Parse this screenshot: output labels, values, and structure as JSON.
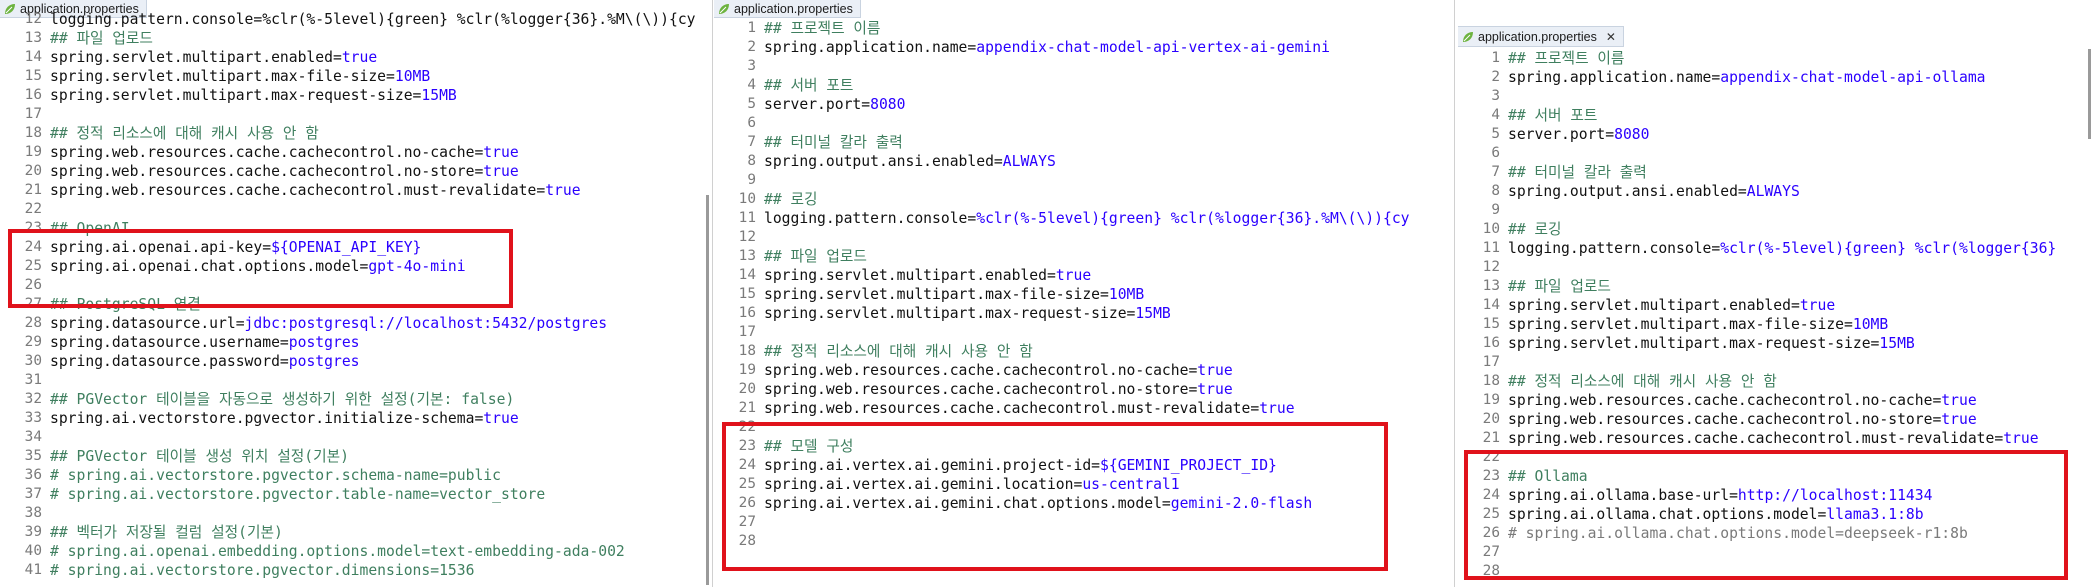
{
  "colors": {
    "key": "#111111",
    "value": "#2a00ff",
    "comment": "#3f7f5f",
    "highlight_box": "#e0121b"
  },
  "panes": [
    {
      "tab": {
        "icon": "leaf-icon",
        "label": "application.properties",
        "close": ""
      },
      "lines": [
        {
          "n": "12",
          "p": [
            {
              "t": "logging.pattern.console=%clr(%-5level){green} %clr(%logger{36}.%M\\(\\)){cy",
              "s": "k"
            }
          ]
        },
        {
          "n": "13",
          "p": [
            {
              "t": "## 파일 업로드",
              "s": "c"
            }
          ]
        },
        {
          "n": "14",
          "p": [
            {
              "t": "spring.servlet.multipart.enabled=",
              "s": "k"
            },
            {
              "t": "true",
              "s": "v"
            }
          ]
        },
        {
          "n": "15",
          "p": [
            {
              "t": "spring.servlet.multipart.max-file-size=",
              "s": "k"
            },
            {
              "t": "10MB",
              "s": "v"
            }
          ]
        },
        {
          "n": "16",
          "p": [
            {
              "t": "spring.servlet.multipart.max-request-size=",
              "s": "k"
            },
            {
              "t": "15MB",
              "s": "v"
            }
          ]
        },
        {
          "n": "17",
          "p": []
        },
        {
          "n": "18",
          "p": [
            {
              "t": "## 정적 리소스에 대해 캐시 사용 안 함",
              "s": "c"
            }
          ]
        },
        {
          "n": "19",
          "p": [
            {
              "t": "spring.web.resources.cache.cachecontrol.no-cache=",
              "s": "k"
            },
            {
              "t": "true",
              "s": "v"
            }
          ]
        },
        {
          "n": "20",
          "p": [
            {
              "t": "spring.web.resources.cache.cachecontrol.no-store=",
              "s": "k"
            },
            {
              "t": "true",
              "s": "v"
            }
          ]
        },
        {
          "n": "21",
          "p": [
            {
              "t": "spring.web.resources.cache.cachecontrol.must-revalidate=",
              "s": "k"
            },
            {
              "t": "true",
              "s": "v"
            }
          ]
        },
        {
          "n": "22",
          "p": []
        },
        {
          "n": "23",
          "p": [
            {
              "t": "## OpenAI",
              "s": "c"
            }
          ]
        },
        {
          "n": "24",
          "p": [
            {
              "t": "spring.ai.openai.api-key=",
              "s": "k"
            },
            {
              "t": "${OPENAI_API_KEY}",
              "s": "v"
            }
          ]
        },
        {
          "n": "25",
          "p": [
            {
              "t": "spring.ai.openai.chat.options.model=",
              "s": "k"
            },
            {
              "t": "gpt-4o-mini",
              "s": "v"
            }
          ]
        },
        {
          "n": "26",
          "p": []
        },
        {
          "n": "27",
          "p": [
            {
              "t": "## PostgreSQL 연결",
              "s": "c"
            }
          ]
        },
        {
          "n": "28",
          "p": [
            {
              "t": "spring.datasource.url=",
              "s": "k"
            },
            {
              "t": "jdbc:postgresql://localhost:5432/postgres",
              "s": "v"
            }
          ]
        },
        {
          "n": "29",
          "p": [
            {
              "t": "spring.datasource.username=",
              "s": "k"
            },
            {
              "t": "postgres",
              "s": "v"
            }
          ]
        },
        {
          "n": "30",
          "p": [
            {
              "t": "spring.datasource.password=",
              "s": "k"
            },
            {
              "t": "postgres",
              "s": "v"
            }
          ]
        },
        {
          "n": "31",
          "p": []
        },
        {
          "n": "32",
          "p": [
            {
              "t": "## PGVector 테이블을 자동으로 생성하기 위한 설정(기본: false)",
              "s": "c"
            }
          ]
        },
        {
          "n": "33",
          "p": [
            {
              "t": "spring.ai.vectorstore.pgvector.initialize-schema=",
              "s": "k"
            },
            {
              "t": "true",
              "s": "v"
            }
          ]
        },
        {
          "n": "34",
          "p": []
        },
        {
          "n": "35",
          "p": [
            {
              "t": "## PGVector 테이블 생성 위치 설정(기본)",
              "s": "c"
            }
          ]
        },
        {
          "n": "36",
          "p": [
            {
              "t": "# spring.ai.vectorstore.pgvector.schema-name=public",
              "s": "c"
            }
          ]
        },
        {
          "n": "37",
          "p": [
            {
              "t": "# spring.ai.vectorstore.pgvector.table-name=vector_store",
              "s": "c"
            }
          ]
        },
        {
          "n": "38",
          "p": []
        },
        {
          "n": "39",
          "p": [
            {
              "t": "## 벡터가 저장될 컬럼 설정(기본)",
              "s": "c"
            }
          ]
        },
        {
          "n": "40",
          "p": [
            {
              "t": "# spring.ai.openai.embedding.options.model=text-embedding-ada-002",
              "s": "c"
            }
          ]
        },
        {
          "n": "41",
          "p": [
            {
              "t": "# spring.ai.vectorstore.pgvector.dimensions=1536",
              "s": "c"
            }
          ]
        }
      ]
    },
    {
      "tab": {
        "icon": "leaf-icon",
        "label": "application.properties",
        "close": ""
      },
      "lines": [
        {
          "n": "1",
          "p": [
            {
              "t": "## 프로젝트 이름",
              "s": "c"
            }
          ]
        },
        {
          "n": "2",
          "p": [
            {
              "t": "spring.application.name=",
              "s": "k"
            },
            {
              "t": "appendix-chat-model-api-vertex-ai-gemini",
              "s": "v"
            }
          ]
        },
        {
          "n": "3",
          "p": []
        },
        {
          "n": "4",
          "p": [
            {
              "t": "## 서버 포트",
              "s": "c"
            }
          ]
        },
        {
          "n": "5",
          "p": [
            {
              "t": "server.port=",
              "s": "k"
            },
            {
              "t": "8080",
              "s": "v"
            }
          ]
        },
        {
          "n": "6",
          "p": []
        },
        {
          "n": "7",
          "p": [
            {
              "t": "## 터미널 칼라 출력",
              "s": "c"
            }
          ]
        },
        {
          "n": "8",
          "p": [
            {
              "t": "spring.output.ansi.enabled=",
              "s": "k"
            },
            {
              "t": "ALWAYS",
              "s": "v"
            }
          ]
        },
        {
          "n": "9",
          "p": []
        },
        {
          "n": "10",
          "p": [
            {
              "t": "## 로깅",
              "s": "c"
            }
          ]
        },
        {
          "n": "11",
          "p": [
            {
              "t": "logging.pattern.console=",
              "s": "k"
            },
            {
              "t": "%clr(%-5level){green} %clr(%logger{36}.%M\\(\\)){cy",
              "s": "v"
            }
          ]
        },
        {
          "n": "12",
          "p": []
        },
        {
          "n": "13",
          "p": [
            {
              "t": "## 파일 업로드",
              "s": "c"
            }
          ]
        },
        {
          "n": "14",
          "p": [
            {
              "t": "spring.servlet.multipart.enabled=",
              "s": "k"
            },
            {
              "t": "true",
              "s": "v"
            }
          ]
        },
        {
          "n": "15",
          "p": [
            {
              "t": "spring.servlet.multipart.max-file-size=",
              "s": "k"
            },
            {
              "t": "10MB",
              "s": "v"
            }
          ]
        },
        {
          "n": "16",
          "p": [
            {
              "t": "spring.servlet.multipart.max-request-size=",
              "s": "k"
            },
            {
              "t": "15MB",
              "s": "v"
            }
          ]
        },
        {
          "n": "17",
          "p": []
        },
        {
          "n": "18",
          "p": [
            {
              "t": "## 정적 리소스에 대해 캐시 사용 안 함",
              "s": "c"
            }
          ]
        },
        {
          "n": "19",
          "p": [
            {
              "t": "spring.web.resources.cache.cachecontrol.no-cache=",
              "s": "k"
            },
            {
              "t": "true",
              "s": "v"
            }
          ]
        },
        {
          "n": "20",
          "p": [
            {
              "t": "spring.web.resources.cache.cachecontrol.no-store=",
              "s": "k"
            },
            {
              "t": "true",
              "s": "v"
            }
          ]
        },
        {
          "n": "21",
          "p": [
            {
              "t": "spring.web.resources.cache.cachecontrol.must-revalidate=",
              "s": "k"
            },
            {
              "t": "true",
              "s": "v"
            }
          ]
        },
        {
          "n": "22",
          "p": []
        },
        {
          "n": "23",
          "p": [
            {
              "t": "## 모델 구성",
              "s": "c"
            }
          ]
        },
        {
          "n": "24",
          "p": [
            {
              "t": "spring.ai.vertex.ai.gemini.project-id=",
              "s": "k"
            },
            {
              "t": "${GEMINI_PROJECT_ID}",
              "s": "v"
            }
          ]
        },
        {
          "n": "25",
          "p": [
            {
              "t": "spring.ai.vertex.ai.gemini.location=",
              "s": "k"
            },
            {
              "t": "us-central1",
              "s": "v"
            }
          ]
        },
        {
          "n": "26",
          "p": [
            {
              "t": "spring.ai.vertex.ai.gemini.chat.options.model=",
              "s": "k"
            },
            {
              "t": "gemini-2.0-flash",
              "s": "v"
            }
          ]
        },
        {
          "n": "27",
          "p": []
        },
        {
          "n": "28",
          "p": []
        }
      ]
    },
    {
      "tab": {
        "icon": "leaf-icon",
        "label": "application.properties",
        "close": ""
      },
      "lines": [
        {
          "n": "1",
          "p": [
            {
              "t": "## 프로젝트 이름",
              "s": "c"
            }
          ]
        },
        {
          "n": "2",
          "p": [
            {
              "t": "spring.application.name=",
              "s": "k"
            },
            {
              "t": "appendix-chat-model-api-ollama",
              "s": "v"
            }
          ]
        },
        {
          "n": "3",
          "p": []
        },
        {
          "n": "4",
          "p": [
            {
              "t": "## 서버 포트",
              "s": "c"
            }
          ]
        },
        {
          "n": "5",
          "p": [
            {
              "t": "server.port=",
              "s": "k"
            },
            {
              "t": "8080",
              "s": "v"
            }
          ]
        },
        {
          "n": "6",
          "p": []
        },
        {
          "n": "7",
          "p": [
            {
              "t": "## 터미널 칼라 출력",
              "s": "c"
            }
          ]
        },
        {
          "n": "8",
          "p": [
            {
              "t": "spring.output.ansi.enabled=",
              "s": "k"
            },
            {
              "t": "ALWAYS",
              "s": "v"
            }
          ]
        },
        {
          "n": "9",
          "p": []
        },
        {
          "n": "10",
          "p": [
            {
              "t": "## 로깅",
              "s": "c"
            }
          ]
        },
        {
          "n": "11",
          "p": [
            {
              "t": "logging.pattern.console=",
              "s": "k"
            },
            {
              "t": "%clr(%-5level){green} %clr(%logger{36}",
              "s": "v"
            }
          ]
        },
        {
          "n": "12",
          "p": []
        },
        {
          "n": "13",
          "p": [
            {
              "t": "## 파일 업로드",
              "s": "c"
            }
          ]
        },
        {
          "n": "14",
          "p": [
            {
              "t": "spring.servlet.multipart.enabled=",
              "s": "k"
            },
            {
              "t": "true",
              "s": "v"
            }
          ]
        },
        {
          "n": "15",
          "p": [
            {
              "t": "spring.servlet.multipart.max-file-size=",
              "s": "k"
            },
            {
              "t": "10MB",
              "s": "v"
            }
          ]
        },
        {
          "n": "16",
          "p": [
            {
              "t": "spring.servlet.multipart.max-request-size=",
              "s": "k"
            },
            {
              "t": "15MB",
              "s": "v"
            }
          ]
        },
        {
          "n": "17",
          "p": []
        },
        {
          "n": "18",
          "p": [
            {
              "t": "## 정적 리소스에 대해 캐시 사용 안 함",
              "s": "c"
            }
          ]
        },
        {
          "n": "19",
          "p": [
            {
              "t": "spring.web.resources.cache.cachecontrol.no-cache=",
              "s": "k"
            },
            {
              "t": "true",
              "s": "v"
            }
          ]
        },
        {
          "n": "20",
          "p": [
            {
              "t": "spring.web.resources.cache.cachecontrol.no-store=",
              "s": "k"
            },
            {
              "t": "true",
              "s": "v"
            }
          ]
        },
        {
          "n": "21",
          "p": [
            {
              "t": "spring.web.resources.cache.cachecontrol.must-revalidate=",
              "s": "k"
            },
            {
              "t": "true",
              "s": "v"
            }
          ]
        },
        {
          "n": "22",
          "p": []
        },
        {
          "n": "23",
          "p": [
            {
              "t": "## Ollama",
              "s": "c"
            }
          ]
        },
        {
          "n": "24",
          "p": [
            {
              "t": "spring.ai.ollama.base-url=",
              "s": "k"
            },
            {
              "t": "http://localhost:11434",
              "s": "v"
            }
          ]
        },
        {
          "n": "25",
          "p": [
            {
              "t": "spring.ai.ollama.chat.options.model=",
              "s": "k"
            },
            {
              "t": "llama3.1:8b",
              "s": "v"
            }
          ]
        },
        {
          "n": "26",
          "p": [
            {
              "t": "# spring.ai.ollama.chat.options.model=deepseek-r1:8b",
              "s": "c2"
            }
          ]
        },
        {
          "n": "27",
          "p": []
        },
        {
          "n": "28",
          "p": []
        }
      ]
    }
  ]
}
